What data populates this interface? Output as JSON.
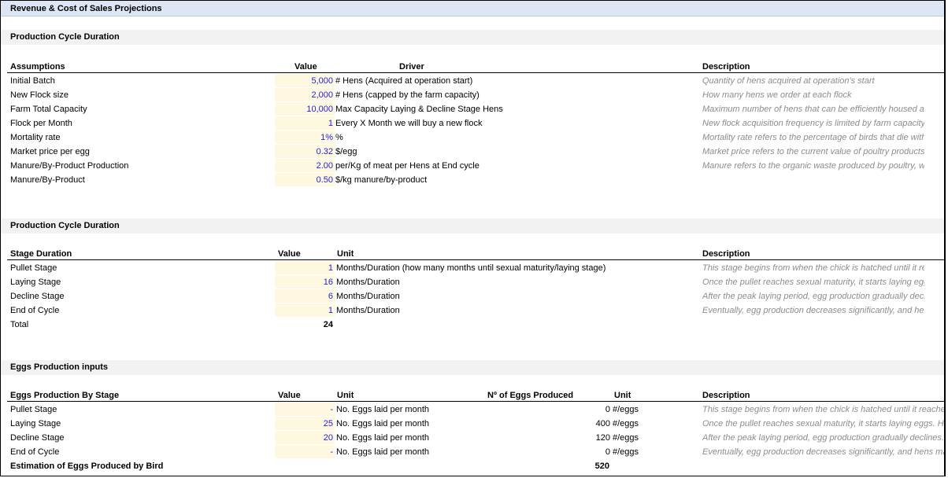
{
  "title": "Revenue & Cost of Sales Projections",
  "section1": {
    "heading": "Production Cycle Duration",
    "headers": {
      "assumptions": "Assumptions",
      "value": "Value",
      "driver": "Driver",
      "description": "Description"
    },
    "rows": [
      {
        "label": "Initial Batch",
        "value": "5,000",
        "driver": "# Hens (Acquired at operation start)",
        "desc": "Quantity of hens acquired at operation's start"
      },
      {
        "label": "New Flock size",
        "value": "2,000",
        "driver": "# Hens (capped by the farm capacity)",
        "desc": "How many hens we order at each flock"
      },
      {
        "label": "Farm Total Capacity",
        "value": "10,000",
        "driver": "Max Capacity Laying & Decline Stage Hens",
        "desc": "Maximum number of hens that can be efficiently housed and managed within"
      },
      {
        "label": "Flock per Month",
        "value": "1",
        "driver": "Every X Month we will buy a new flock",
        "desc": "New flock acquisition frequency is limited by farm capacity. When operating a"
      },
      {
        "label": "Mortality rate",
        "value": "1%",
        "driver": "%",
        "desc": "Mortality rate refers to the percentage of birds that die within a specified mo"
      },
      {
        "label": "Market price per egg",
        "value": "0.32",
        "driver": "$/egg",
        "desc": "Market price refers to the current value of poultry products, such as eggs or m"
      },
      {
        "label": "Manure/By-Product Production",
        "value": "2.00",
        "driver": "per/Kg of meat per Hens at End cycle",
        "desc": "Manure refers to the organic waste produced by poultry, which can be used a"
      },
      {
        "label": "Manure/By-Product",
        "value": "0.50",
        "driver": "$/kg manure/by-product",
        "desc": ""
      }
    ]
  },
  "section2": {
    "heading": "Production Cycle Duration",
    "headers": {
      "stage": "Stage Duration",
      "value": "Value",
      "unit": "Unit",
      "description": "Description"
    },
    "rows": [
      {
        "label": "Pullet Stage",
        "value": "1",
        "unit": "Months/Duration (how many months until sexual maturity/laying stage)",
        "desc": "This stage begins from when the chick is hatched until it reaches sexual matu"
      },
      {
        "label": "Laying Stage",
        "value": "16",
        "unit": "Months/Duration",
        "desc": "Once the pullet reaches sexual maturity, it starts laying eggs. Hens in comme"
      },
      {
        "label": "Decline Stage",
        "value": "6",
        "unit": "Months/Duration",
        "desc": "After the peak laying period, egg production gradually declines. This decline p"
      },
      {
        "label": "End of Cycle",
        "value": "1",
        "unit": "Months/Duration",
        "desc": "Eventually, egg production decreases significantly, and hens may be replaced"
      }
    ],
    "total_label": "Total",
    "total_value": "24"
  },
  "section3": {
    "heading": "Eggs Production inputs",
    "headers": {
      "stage": "Eggs Production By Stage",
      "value": "Value",
      "unit": "Unit",
      "eggs": "Nº of Eggs Produced",
      "unit2": "Unit",
      "description": "Description"
    },
    "rows": [
      {
        "label": "Pullet Stage",
        "value": "-",
        "unit": "No. Eggs laid per month",
        "eggs": "0",
        "unit2": "#/eggs",
        "desc": "This stage begins from when the chick is hatched until it reaches sexual matu"
      },
      {
        "label": "Laying Stage",
        "value": "25",
        "unit": "No. Eggs laid per month",
        "eggs": "400",
        "unit2": "#/eggs",
        "desc": "Once the pullet reaches sexual maturity, it starts laying eggs. Hens in comme"
      },
      {
        "label": "Decline Stage",
        "value": "20",
        "unit": "No. Eggs laid per month",
        "eggs": "120",
        "unit2": "#/eggs",
        "desc": "After the peak laying period, egg production gradually declines. This decline p"
      },
      {
        "label": "End of Cycle",
        "value": "-",
        "unit": "No. Eggs laid per month",
        "eggs": "0",
        "unit2": "#/eggs",
        "desc": "Eventually, egg production decreases significantly, and hens may be replaced"
      }
    ],
    "total_label": "Estimation of Eggs Produced by Bird",
    "total_value": "520"
  }
}
